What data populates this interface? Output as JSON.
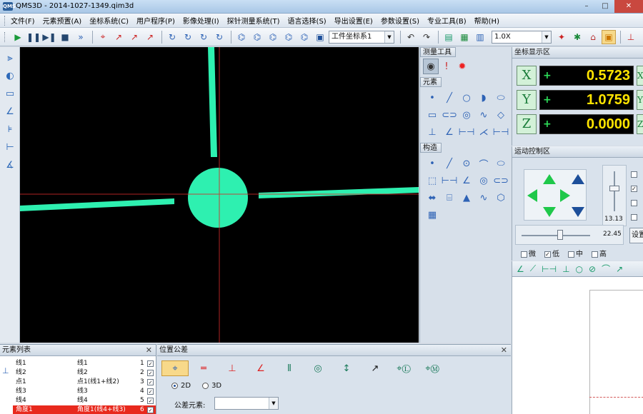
{
  "window": {
    "title": "QMS3D - 2014-1027-1349.qim3d",
    "app_icon": "QMS",
    "minimize": "–",
    "maximize": "□",
    "close": "✕"
  },
  "menu": [
    "文件(F)",
    "元素预置(A)",
    "坐标系统(C)",
    "用户程序(P)",
    "影像处理(I)",
    "探针测量系统(T)",
    "语言选择(S)",
    "导出设置(E)",
    "参数设置(S)",
    "专业工具(B)",
    "帮助(H)"
  ],
  "toolbar": {
    "coordinate_system": "工件坐标系1",
    "zoom": "1.0X"
  },
  "measure_tools": {
    "title": "测量工具"
  },
  "elements_panel": {
    "title": "元素"
  },
  "construct_panel": {
    "title": "构造"
  },
  "coord_display": {
    "title": "坐标显示区",
    "x_label": "X",
    "y_label": "Y",
    "z_label": "Z",
    "sign": "+",
    "x_value": "0.5723",
    "y_value": "1.0759",
    "z_value": "0.0000",
    "x_side": "X",
    "y_side": "Y",
    "z_side": "Z"
  },
  "motion": {
    "title": "运动控制区",
    "vertical_value": "13.13",
    "horizontal_value": "22.45",
    "speeds": [
      "微",
      "低",
      "中",
      "高"
    ],
    "speed_checked": [
      false,
      true,
      false,
      false
    ],
    "settings_button": "设置"
  },
  "element_list": {
    "title": "元素列表",
    "close": "✕",
    "rows": [
      {
        "name": "线1",
        "desc": "线1",
        "index": "1",
        "checked": true,
        "selected": false
      },
      {
        "name": "线2",
        "desc": "线2",
        "index": "2",
        "checked": true,
        "selected": false
      },
      {
        "name": "点1",
        "desc": "点1(线1+线2)",
        "index": "3",
        "checked": true,
        "selected": false
      },
      {
        "name": "线3",
        "desc": "线3",
        "index": "4",
        "checked": true,
        "selected": false
      },
      {
        "name": "线4",
        "desc": "线4",
        "index": "5",
        "checked": true,
        "selected": false
      },
      {
        "name": "角度1",
        "desc": "角度1(线4+线3)",
        "index": "6",
        "checked": true,
        "selected": true
      }
    ]
  },
  "tolerance": {
    "title": "位置公差",
    "close": "✕",
    "option_2d": "2D",
    "option_3d": "3D",
    "element_label": "公差元素:",
    "element_value": ""
  },
  "colors": {
    "feature": "#2ef0b0",
    "crosshair": "#d12a2a",
    "coord_number": "#ffe400",
    "axis_green": "#1b7d3a",
    "selected_row": "#e8291d"
  }
}
